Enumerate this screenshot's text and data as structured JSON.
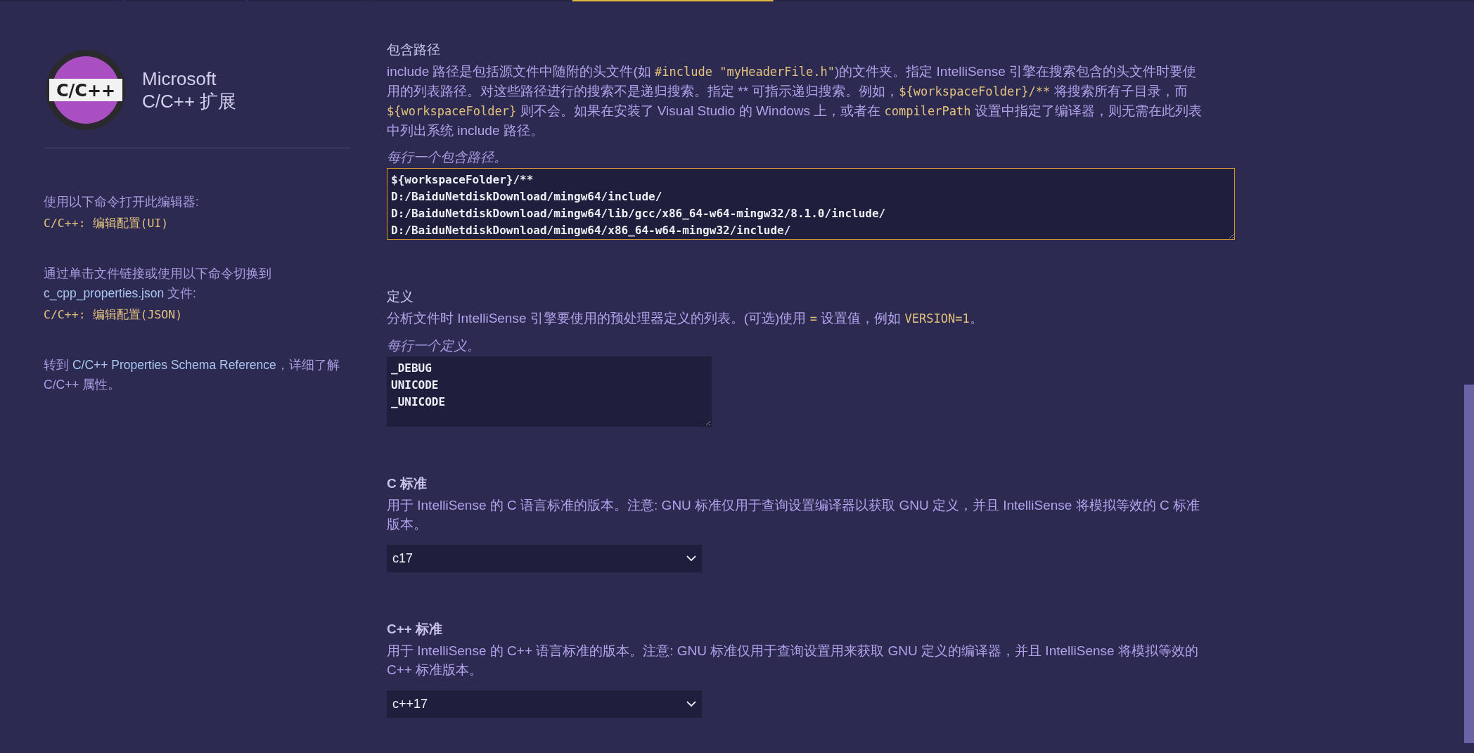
{
  "extension": {
    "logo_text": "C/C++",
    "title": [
      "Microsoft",
      "C/C++ 扩展"
    ]
  },
  "sidebar": [
    {
      "segments": [
        {
          "kind": "text",
          "text": "使用以下命令打开此编辑器:"
        }
      ],
      "command": "C/C++: 编辑配置(UI)"
    },
    {
      "segments": [
        {
          "kind": "text",
          "text": "通过单击文件链接或使用以下命令切换到 "
        },
        {
          "kind": "link",
          "text": "c_cpp_properties.json"
        },
        {
          "kind": "text",
          "text": " 文件:"
        }
      ],
      "command": "C/C++: 编辑配置(JSON)"
    },
    {
      "segments": [
        {
          "kind": "text",
          "text": "转到 "
        },
        {
          "kind": "link",
          "text": "C/C++ Properties Schema Reference"
        },
        {
          "kind": "text",
          "text": "，详细了解 C/C++ 属性。"
        }
      ]
    }
  ],
  "settings": [
    {
      "kind": "list",
      "label": "包含路径",
      "bold": false,
      "description": [
        {
          "kind": "text",
          "text": "include 路径是包括源文件中随附的头文件(如 "
        },
        {
          "kind": "code",
          "text": "#include \"myHeaderFile.h\""
        },
        {
          "kind": "text",
          "text": ")的文件夹。指定 IntelliSense 引擎在搜索包含的头文件时要使用的列表路径。对这些路径进行的搜索不是递归搜索。指定 ** 可指示递归搜索。例如，"
        },
        {
          "kind": "code",
          "text": "${workspaceFolder}/**"
        },
        {
          "kind": "text",
          "text": " 将搜索所有子目录，而 "
        },
        {
          "kind": "code",
          "text": "${workspaceFolder}"
        },
        {
          "kind": "text",
          "text": " 则不会。如果在安装了 Visual Studio 的 Windows 上，或者在 "
        },
        {
          "kind": "code",
          "text": "compilerPath"
        },
        {
          "kind": "text",
          "text": " 设置中指定了编译器，则无需在此列表中列出系统 include 路径。"
        }
      ],
      "hint": "每行一个包含路径。",
      "focused": true,
      "wide": true,
      "lines": [
        "${workspaceFolder}/**",
        "D:/BaiduNetdiskDownload/mingw64/include/",
        "D:/BaiduNetdiskDownload/mingw64/lib/gcc/x86_64-w64-mingw32/8.1.0/include/",
        "D:/BaiduNetdiskDownload/mingw64/x86_64-w64-mingw32/include/"
      ]
    },
    {
      "kind": "list",
      "label": "定义",
      "bold": false,
      "description": [
        {
          "kind": "text",
          "text": "分析文件时 IntelliSense 引擎要使用的预处理器定义的列表。(可选)使用 "
        },
        {
          "kind": "code",
          "text": "="
        },
        {
          "kind": "text",
          "text": " 设置值，例如 "
        },
        {
          "kind": "code",
          "text": "VERSION=1"
        },
        {
          "kind": "text",
          "text": "。"
        }
      ],
      "hint": "每行一个定义。",
      "focused": false,
      "wide": false,
      "lines": [
        "_DEBUG",
        "UNICODE",
        "_UNICODE"
      ]
    },
    {
      "kind": "select",
      "label": "C 标准",
      "bold": true,
      "description": [
        {
          "kind": "text",
          "text": "用于 IntelliSense 的 C 语言标准的版本。注意: GNU 标准仅用于查询设置编译器以获取 GNU 定义，并且 IntelliSense 将模拟等效的 C 标准版本。"
        }
      ],
      "value": "c17"
    },
    {
      "kind": "select",
      "label": "C++ 标准",
      "bold": true,
      "description": [
        {
          "kind": "text",
          "text": "用于 IntelliSense 的 C++ 语言标准的版本。注意: GNU 标准仅用于查询设置用来获取 GNU 定义的编译器，并且 IntelliSense 将模拟等效的 C++ 标准版本。"
        }
      ],
      "value": "c++17"
    }
  ]
}
